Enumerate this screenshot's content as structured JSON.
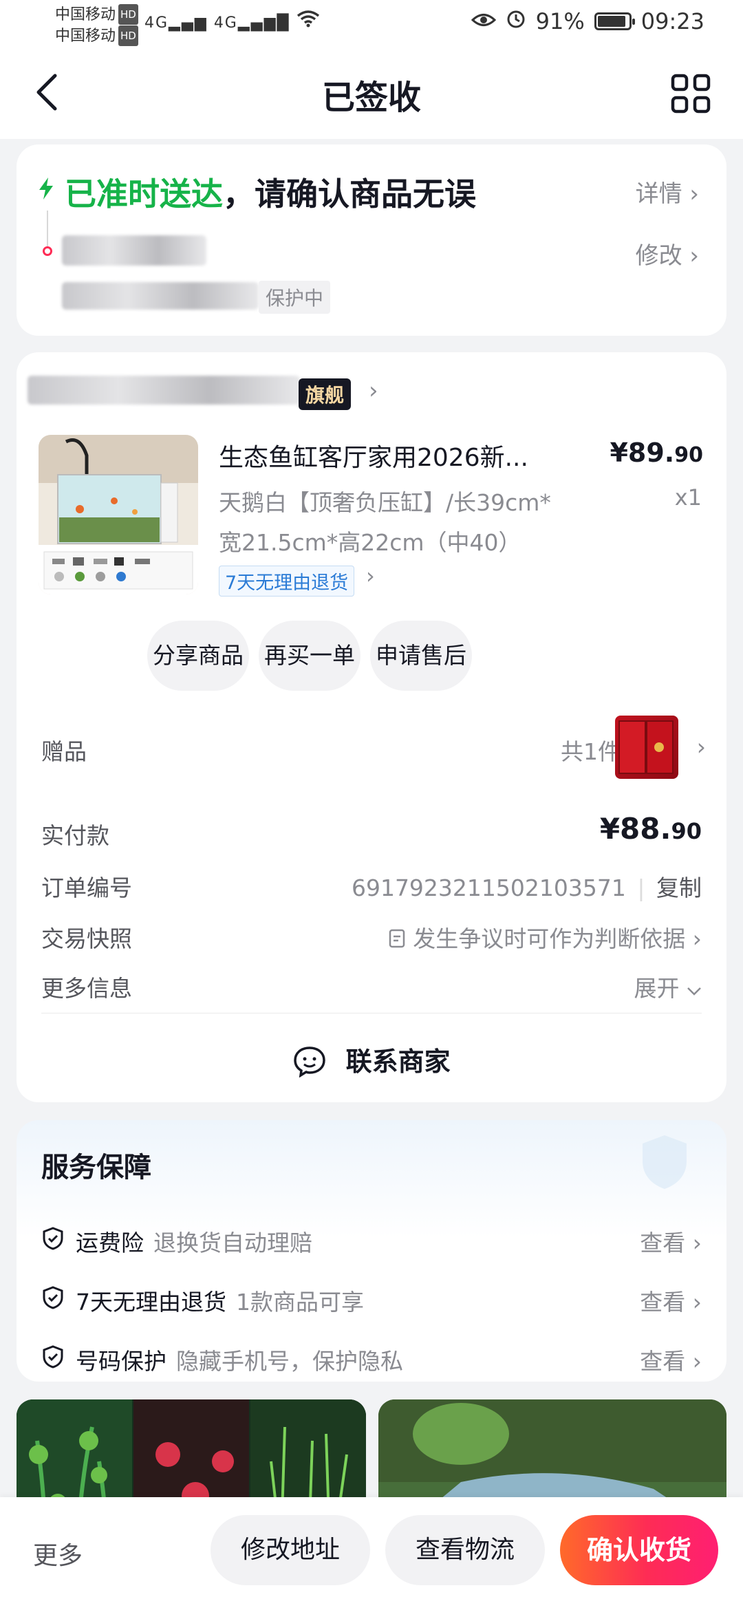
{
  "status_bar": {
    "carrier_1": "中国移动",
    "carrier_2": "中国移动",
    "hd": "HD",
    "network": "4G",
    "battery_percent": "91%",
    "battery_level": 0.91,
    "time": "09:23"
  },
  "nav": {
    "title": "已签收"
  },
  "delivery": {
    "title_highlight": "已准时送达",
    "title_rest": "，请确认商品无误",
    "detail_link": "详情",
    "modify_link": "修改",
    "protection": "保护中"
  },
  "shop": {
    "badge": "旗舰"
  },
  "product": {
    "name": "生态鱼缸客厅家用2026新...",
    "price_main": "¥89.",
    "price_decimal": "90",
    "sku": "天鹅白【顶奢负压缸】/长39cm*宽21.5cm*高22cm（中40）",
    "quantity": "x1",
    "return_tag": "7天无理由退货"
  },
  "actions": {
    "share": "分享商品",
    "rebuy": "再买一单",
    "after_sale": "申请售后"
  },
  "order": {
    "gift_label": "赠品",
    "gift_count": "共1件",
    "paid_label": "实付款",
    "paid_main": "¥88.",
    "paid_decimal": "90",
    "order_no_label": "订单编号",
    "order_no": "6917923211502103571",
    "copy": "复制",
    "snapshot_label": "交易快照",
    "snapshot_value": "发生争议时可作为判断依据",
    "more_label": "更多信息",
    "expand": "展开",
    "contact": "联系商家"
  },
  "service": {
    "title": "服务保障",
    "items": [
      {
        "name": "运费险",
        "desc": "退换货自动理赔",
        "action": "查看"
      },
      {
        "name": "7天无理由退货",
        "desc": "1款商品可享",
        "action": "查看"
      },
      {
        "name": "号码保护",
        "desc": "隐藏手机号，保护隐私",
        "action": "查看"
      }
    ]
  },
  "bottom_bar": {
    "more": "更多",
    "modify_address": "修改地址",
    "view_logistics": "查看物流",
    "confirm": "确认收货"
  },
  "colors": {
    "accent": "#fe2c55",
    "success": "#16b349",
    "link_blue": "#2b7bd6"
  }
}
